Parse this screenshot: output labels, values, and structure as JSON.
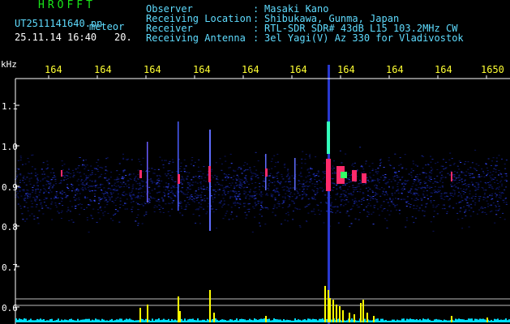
{
  "header": {
    "brand": "HROFFT",
    "file_name": "UT2511141640.pn",
    "detection_label": "meteor",
    "datetime": "25.11.14 16:40",
    "count": "20."
  },
  "station_info": [
    {
      "label": "Observer",
      "value": "Masaki Kano"
    },
    {
      "label": "Receiving Location",
      "value": "Shibukawa, Gunma, Japan"
    },
    {
      "label": "Receiver",
      "value": "RTL-SDR SDR# 43dB L15 103.2MHz CW"
    },
    {
      "label": "Receiving Antenna",
      "value": "3el Yagi(V) Az 330 for Vladivostok"
    }
  ],
  "axis": {
    "unit_label": "kHz",
    "x_ticks": [
      "164",
      "164",
      "164",
      "164",
      "164",
      "164",
      "164",
      "164",
      "164",
      "1650"
    ],
    "y_ticks": [
      "1.1",
      "1.0",
      "0.9",
      "0.8",
      "0.7",
      "0.6"
    ]
  },
  "colors": {
    "text_cyan": "#5fdcff",
    "brand_green": "#19e619",
    "tick_yellow": "#ffff33",
    "noise_blue": "#1a2aa0",
    "echo_red": "#ff2a6a",
    "level_yellow": "#ffff00",
    "baseline_cyan": "#00e0ff"
  }
}
